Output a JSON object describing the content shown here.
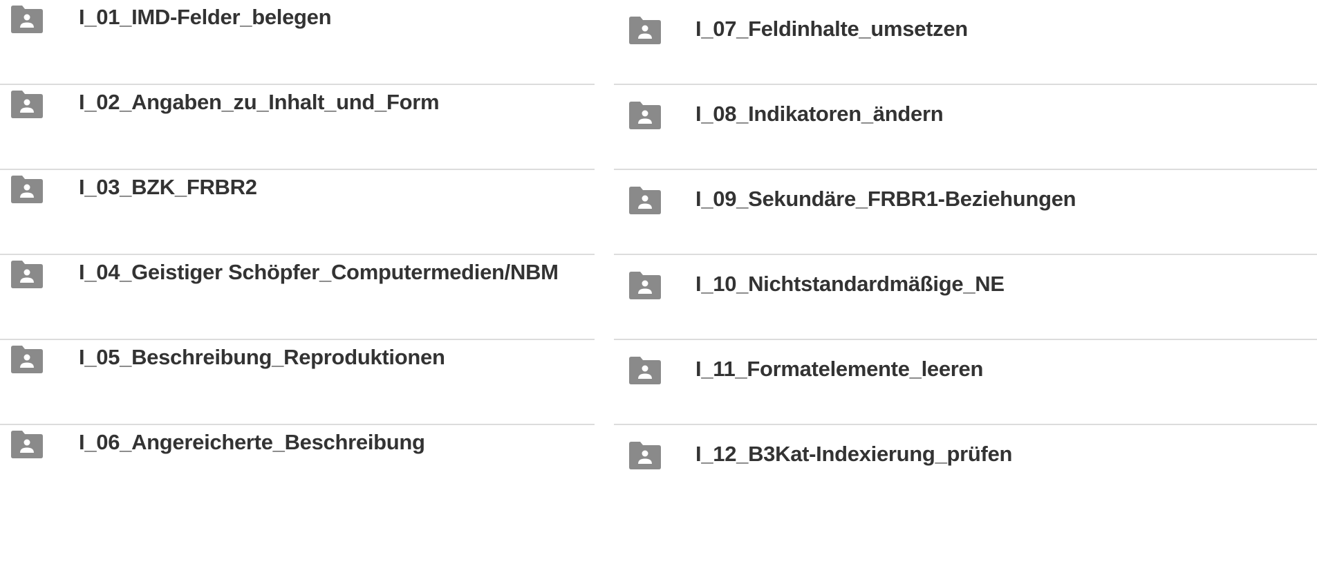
{
  "left_column": [
    {
      "name": "I_01_IMD-Felder_belegen",
      "icon": "shared-folder-icon"
    },
    {
      "name": "I_02_Angaben_zu_Inhalt_und_Form",
      "icon": "shared-folder-icon"
    },
    {
      "name": "I_03_BZK_FRBR2",
      "icon": "shared-folder-icon"
    },
    {
      "name": "I_04_Geistiger Schöpfer_Computermedien/NBM",
      "icon": "shared-folder-icon"
    },
    {
      "name": "I_05_Beschreibung_Reproduktionen",
      "icon": "shared-folder-icon"
    },
    {
      "name": "I_06_Angereicherte_Beschreibung",
      "icon": "shared-folder-icon"
    }
  ],
  "right_column": [
    {
      "name": "I_07_Feldinhalte_umsetzen",
      "icon": "shared-folder-icon"
    },
    {
      "name": "I_08_Indikatoren_ändern",
      "icon": "shared-folder-icon"
    },
    {
      "name": "I_09_Sekundäre_FRBR1-Beziehungen",
      "icon": "shared-folder-icon"
    },
    {
      "name": "I_10_Nichtstandardmäßige_NE",
      "icon": "shared-folder-icon"
    },
    {
      "name": "I_11_Formatelemente_leeren",
      "icon": "shared-folder-icon"
    },
    {
      "name": "I_12_B3Kat-Indexierung_prüfen",
      "icon": "shared-folder-icon"
    }
  ],
  "colors": {
    "icon": "#8a8a8a",
    "text": "#333333",
    "divider": "#dcdcdc",
    "background": "#ffffff"
  }
}
